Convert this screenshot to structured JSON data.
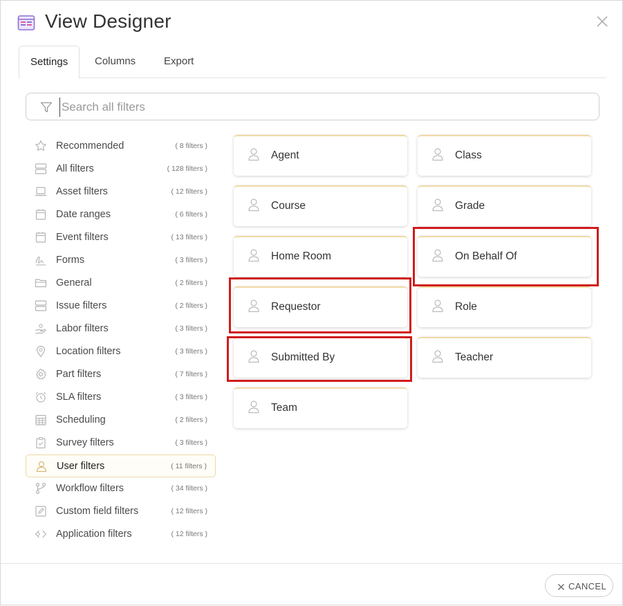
{
  "window": {
    "title": "View Designer"
  },
  "tabs": [
    {
      "label": "Settings",
      "active": true
    },
    {
      "label": "Columns",
      "active": false
    },
    {
      "label": "Export",
      "active": false
    }
  ],
  "search": {
    "placeholder": "Search all filters",
    "value": ""
  },
  "sidebar": {
    "items": [
      {
        "label": "Recommended",
        "count": "( 8 filters )",
        "icon": "star-icon"
      },
      {
        "label": "All filters",
        "count": "( 128 filters )",
        "icon": "server-icon"
      },
      {
        "label": "Asset filters",
        "count": "( 12 filters )",
        "icon": "laptop-icon"
      },
      {
        "label": "Date ranges",
        "count": "( 6 filters )",
        "icon": "calendar-icon"
      },
      {
        "label": "Event filters",
        "count": "( 13 filters )",
        "icon": "calendar-icon"
      },
      {
        "label": "Forms",
        "count": "( 3 filters )",
        "icon": "signature-icon"
      },
      {
        "label": "General",
        "count": "( 2 filters )",
        "icon": "folder-icon"
      },
      {
        "label": "Issue filters",
        "count": "( 2 filters )",
        "icon": "server-icon"
      },
      {
        "label": "Labor filters",
        "count": "( 3 filters )",
        "icon": "hand-icon"
      },
      {
        "label": "Location filters",
        "count": "( 3 filters )",
        "icon": "map-pin-icon"
      },
      {
        "label": "Part filters",
        "count": "( 7 filters )",
        "icon": "gear-icon"
      },
      {
        "label": "SLA filters",
        "count": "( 3 filters )",
        "icon": "alarm-clock-icon"
      },
      {
        "label": "Scheduling",
        "count": "( 2 filters )",
        "icon": "calendar-grid-icon"
      },
      {
        "label": "Survey filters",
        "count": "( 3 filters )",
        "icon": "clipboard-check-icon"
      },
      {
        "label": "User filters",
        "count": "( 11 filters )",
        "icon": "user-icon",
        "active": true
      },
      {
        "label": "Workflow filters",
        "count": "( 34 filters )",
        "icon": "branch-icon"
      },
      {
        "label": "Custom field filters",
        "count": "( 12 filters )",
        "icon": "edit-icon"
      },
      {
        "label": "Application filters",
        "count": "( 12 filters )",
        "icon": "code-icon"
      }
    ]
  },
  "filters": {
    "cards": [
      {
        "label": "Agent"
      },
      {
        "label": "Class"
      },
      {
        "label": "Course"
      },
      {
        "label": "Grade"
      },
      {
        "label": "Home Room"
      },
      {
        "label": "On Behalf Of",
        "highlighted": true
      },
      {
        "label": "Requestor",
        "highlighted": true
      },
      {
        "label": "Role"
      },
      {
        "label": "Submitted By",
        "highlighted": true
      },
      {
        "label": "Teacher"
      },
      {
        "label": "Team"
      }
    ]
  },
  "footer": {
    "cancel_label": "CANCEL"
  },
  "colors": {
    "accent": "#f0d9a4",
    "active_item_bg": "#fffdf7",
    "highlight": "#d01c1c",
    "icon_gray": "#b5b5b5",
    "app_icon": "#8e6fd6"
  }
}
